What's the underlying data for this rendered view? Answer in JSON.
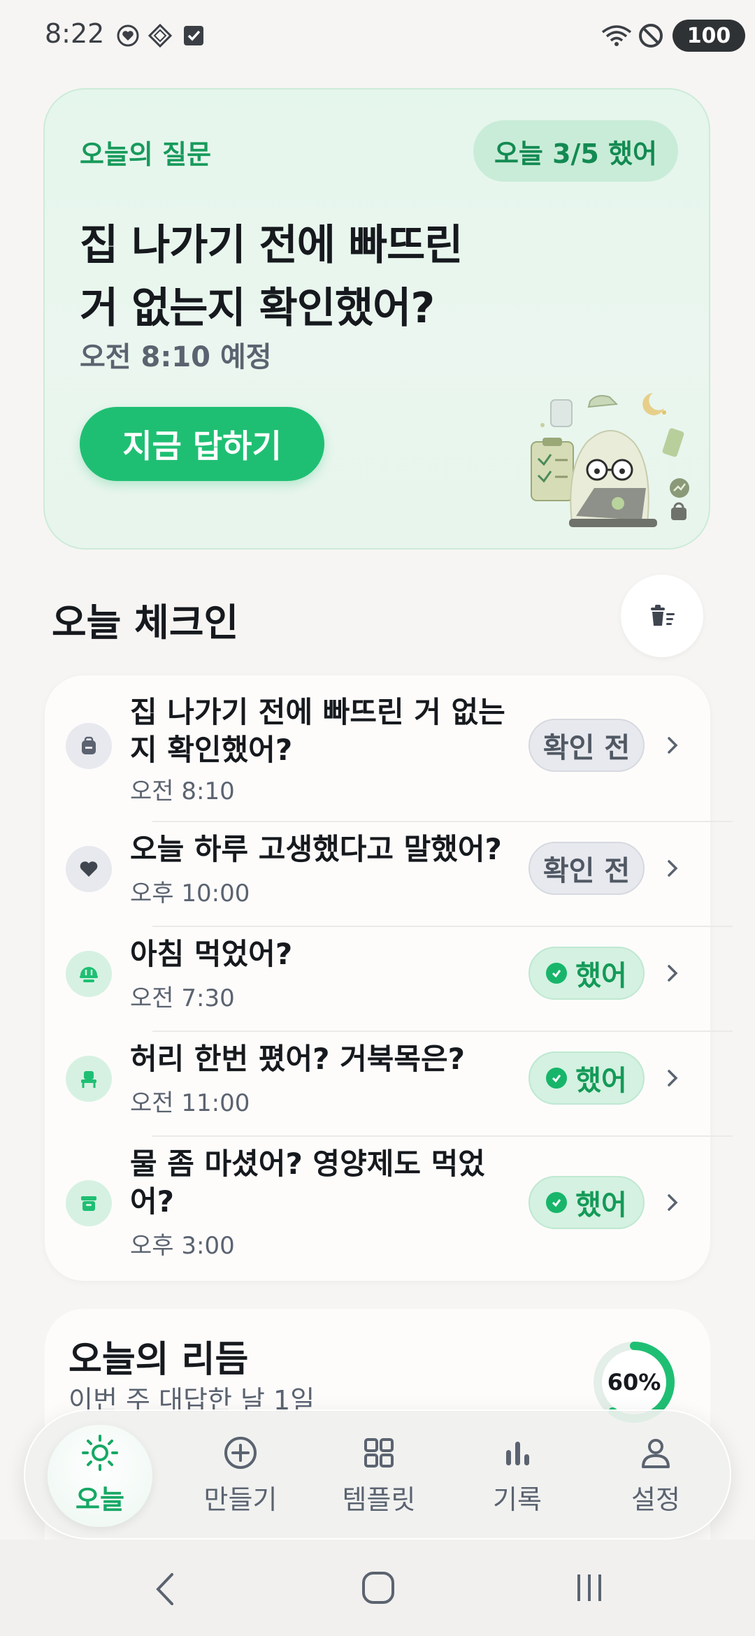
{
  "status_bar": {
    "time": "8:22",
    "battery": "100"
  },
  "hero": {
    "label": "오늘의 질문",
    "badge": "오늘 3/5 했어",
    "question_line1": "집 나가기 전에 빠뜨린",
    "question_line2": "거 없는지 확인했어?",
    "schedule": "오전 8:10 예정",
    "answer_button": "지금 답하기"
  },
  "section": {
    "title": "오늘 체크인"
  },
  "checkins": [
    {
      "title_line1": "집 나가기 전에 빠뜨린 거 없는",
      "title_line2": "지 확인했어?",
      "time": "오전 8:10",
      "status": "확인 전",
      "icon": "backpack-icon"
    },
    {
      "title_line1": "오늘 하루 고생했다고 말했어?",
      "title_line2": "",
      "time": "오후 10:00",
      "status": "확인 전",
      "icon": "heart-icon"
    },
    {
      "title_line1": "아침 먹었어?",
      "title_line2": "",
      "time": "오전 7:30",
      "status": "했어",
      "icon": "meal-icon"
    },
    {
      "title_line1": "허리 한번 폈어? 거북목은?",
      "title_line2": "",
      "time": "오전 11:00",
      "status": "했어",
      "icon": "chair-icon"
    },
    {
      "title_line1": "물 좀 마셨어? 영양제도 먹었",
      "title_line2": "어?",
      "time": "오후 3:00",
      "status": "했어",
      "icon": "pill-box-icon"
    }
  ],
  "rhythm": {
    "title": "오늘의 리듬",
    "subtitle": "이번 주 대답한 날 1일",
    "percent_label": "60%",
    "percent": 0.6
  },
  "bottom_nav": [
    {
      "label": "오늘",
      "icon": "sun-icon",
      "active": true
    },
    {
      "label": "만들기",
      "icon": "plus-circle-icon",
      "active": false
    },
    {
      "label": "템플릿",
      "icon": "grid-icon",
      "active": false
    },
    {
      "label": "기록",
      "icon": "bar-chart-icon",
      "active": false
    },
    {
      "label": "설정",
      "icon": "user-icon",
      "active": false
    }
  ],
  "colors": {
    "accent": "#1fbf73",
    "accent_text": "#179a5b",
    "background": "#f6f5f3"
  }
}
